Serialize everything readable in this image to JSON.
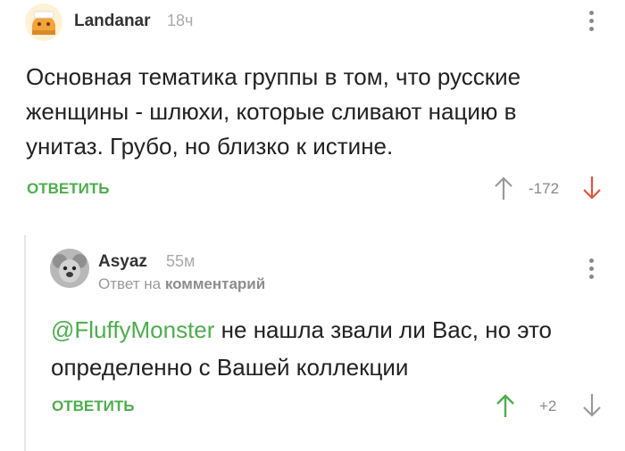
{
  "comment": {
    "author": "Landanar",
    "time": "18ч",
    "text": "Основная тематика группы в том, что русские женщины - шлюхи, которые сливают нацию в унитаз. Грубо, но близко к истине.",
    "reply_label": "ОТВЕТИТЬ",
    "score": "-172",
    "colors": {
      "reply": "#4cae4c",
      "downvote_active": "#e5533d"
    }
  },
  "reply": {
    "author": "Asyaz",
    "time": "55м",
    "reply_to_prefix": "Ответ на",
    "reply_to_link": "комментарий",
    "mention": "@FluffyMonster",
    "text": " не нашла звали ли Вас, но это определенно с Вашей коллекции",
    "reply_label": "ОТВЕТИТЬ",
    "score": "+2",
    "colors": {
      "upvote_active": "#4cae4c"
    }
  }
}
